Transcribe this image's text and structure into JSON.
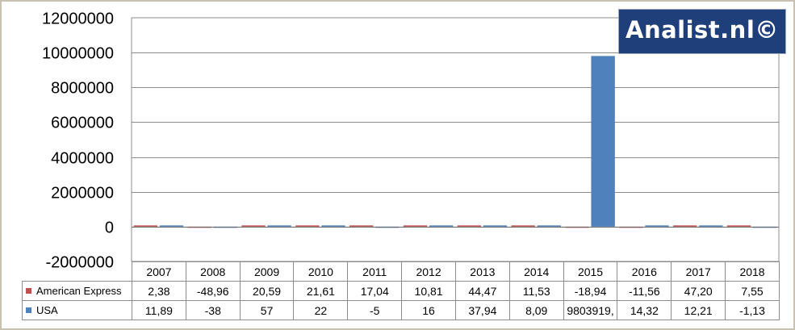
{
  "logo": {
    "text": "Analist.nl©"
  },
  "chart_data": {
    "type": "bar",
    "title": "",
    "xlabel": "",
    "ylabel": "",
    "ylim": [
      -2000000,
      12000000
    ],
    "yticks": [
      12000000,
      10000000,
      8000000,
      6000000,
      4000000,
      2000000,
      0,
      -2000000
    ],
    "ytick_labels": [
      "12000000",
      "10000000",
      "8000000",
      "6000000",
      "4000000",
      "2000000",
      "0",
      "-2000000"
    ],
    "grid": true,
    "legend": "data-table-below",
    "categories": [
      "2007",
      "2008",
      "2009",
      "2010",
      "2011",
      "2012",
      "2013",
      "2014",
      "2015",
      "2016",
      "2017",
      "2018"
    ],
    "series": [
      {
        "name": "American Express",
        "color": "#c0504d",
        "values": [
          2.38,
          -48.96,
          20.59,
          21.61,
          17.04,
          10.81,
          44.47,
          11.53,
          -18.94,
          -11.56,
          47.2,
          7.55
        ],
        "labels": [
          "2,38",
          "-48,96",
          "20,59",
          "21,61",
          "17,04",
          "10,81",
          "44,47",
          "11,53",
          "-18,94",
          "-11,56",
          "47,20",
          "7,55"
        ]
      },
      {
        "name": "USA",
        "color": "#4f81bd",
        "values": [
          11.89,
          -38,
          57,
          22,
          -5,
          16,
          37.94,
          8.09,
          9803919,
          14.32,
          12.21,
          -1.13
        ],
        "labels": [
          "11,89",
          "-38",
          "57",
          "22",
          "-5",
          "16",
          "37,94",
          "8,09",
          "9803919,",
          "14,32",
          "12,21",
          "-1,13"
        ]
      }
    ]
  }
}
